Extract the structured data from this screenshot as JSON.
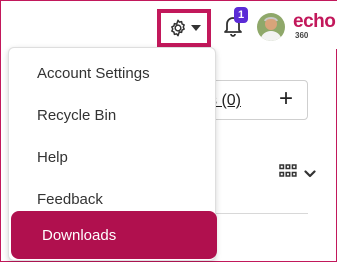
{
  "header": {
    "notification_count": "1",
    "brand_name": "echo",
    "brand_suffix": "360"
  },
  "background": {
    "link_text": "s (0)",
    "plus_label": "+"
  },
  "menu": {
    "items": [
      {
        "label": "Account Settings"
      },
      {
        "label": "Recycle Bin"
      },
      {
        "label": "Help"
      },
      {
        "label": "Feedback"
      },
      {
        "label": "Downloads"
      }
    ],
    "active_index": 4
  },
  "colors": {
    "accent": "#c2185b",
    "active_item_bg": "#b0104e",
    "badge": "#5b2bd6"
  },
  "icons": [
    "gear-icon",
    "caret-down-icon",
    "bell-icon",
    "grid-icon",
    "chevron-down-icon"
  ]
}
